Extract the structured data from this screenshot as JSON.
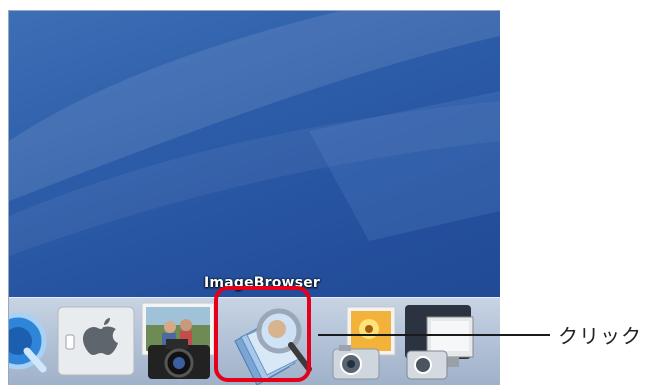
{
  "dock": {
    "label": "ImageBrowser",
    "items": [
      {
        "name": "QuickTime Player",
        "icon": "quicktime-icon"
      },
      {
        "name": "System Preferences",
        "icon": "apple-switch-icon"
      },
      {
        "name": "Camera Photo App",
        "icon": "camera-photo-icon"
      },
      {
        "name": "ImageBrowser",
        "icon": "imagebrowser-magnifier-icon"
      },
      {
        "name": "Photo Camera App",
        "icon": "sunflower-camera-icon"
      },
      {
        "name": "Display Camera App",
        "icon": "monitor-camera-icon"
      }
    ]
  },
  "callout": {
    "text": "クリック"
  },
  "colors": {
    "highlight": "#e3001b",
    "desktop": "#2c5ca8"
  }
}
